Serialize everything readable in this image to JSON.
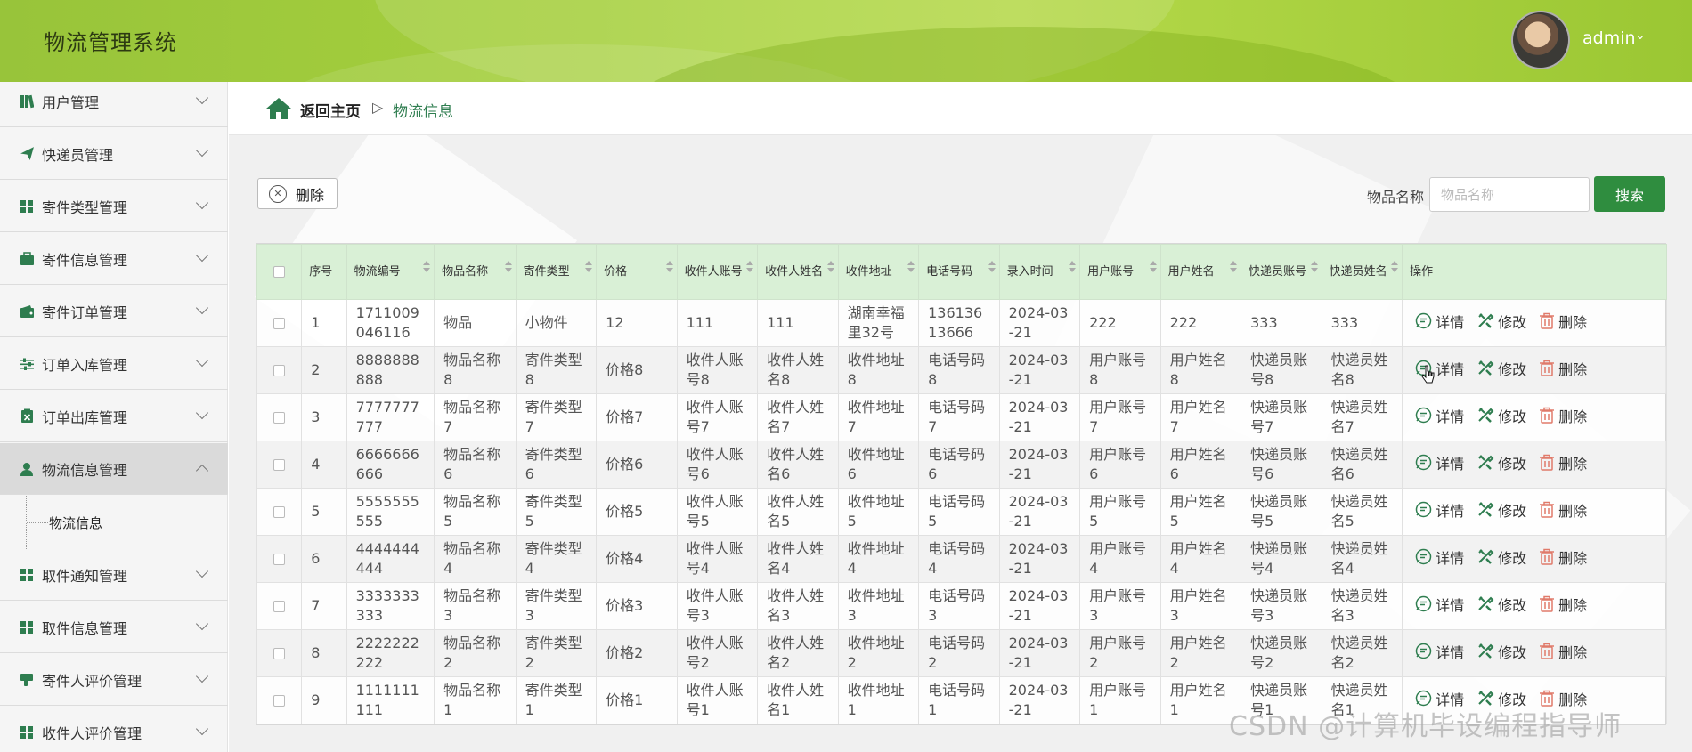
{
  "app": {
    "title": "物流管理系统",
    "user": "admin"
  },
  "sidebar": {
    "items": [
      {
        "label": "用户管理",
        "icon": "book-icon"
      },
      {
        "label": "快递员管理",
        "icon": "paper-plane-icon"
      },
      {
        "label": "寄件类型管理",
        "icon": "grid-icon"
      },
      {
        "label": "寄件信息管理",
        "icon": "briefcase-icon"
      },
      {
        "label": "寄件订单管理",
        "icon": "wallet-icon"
      },
      {
        "label": "订单入库管理",
        "icon": "sliders-icon"
      },
      {
        "label": "订单出库管理",
        "icon": "clipboard-x-icon"
      },
      {
        "label": "物流信息管理",
        "icon": "user-icon"
      },
      {
        "label": "取件通知管理",
        "icon": "grid-icon"
      },
      {
        "label": "取件信息管理",
        "icon": "grid-icon"
      },
      {
        "label": "寄件人评价管理",
        "icon": "thumbs-down-icon"
      },
      {
        "label": "收件人评价管理",
        "icon": "grid-icon"
      }
    ],
    "submenu_label": "物流信息"
  },
  "breadcrumb": {
    "home": "返回主页",
    "separator": "▷",
    "current": "物流信息"
  },
  "toolbar": {
    "delete_label": "删除",
    "search_label": "物品名称",
    "search_placeholder": "物品名称",
    "search_button": "搜索"
  },
  "table": {
    "columns": [
      "序号",
      "物流编号",
      "物品名称",
      "寄件类型",
      "价格",
      "收件人账号",
      "收件人姓名",
      "收件地址",
      "电话号码",
      "录入时间",
      "用户账号",
      "用户姓名",
      "快递员账号",
      "快递员姓名",
      "操作"
    ],
    "actions": {
      "detail": "详情",
      "edit": "修改",
      "delete": "删除"
    },
    "rows": [
      [
        "1",
        "1711009046116",
        "物品",
        "小物件",
        "12",
        "111",
        "111",
        "湖南幸福里32号",
        "13613613666",
        "2024-03-21",
        "222",
        "222",
        "333",
        "333"
      ],
      [
        "2",
        "8888888888",
        "物品名称8",
        "寄件类型8",
        "价格8",
        "收件人账号8",
        "收件人姓名8",
        "收件地址8",
        "电话号码8",
        "2024-03-21",
        "用户账号8",
        "用户姓名8",
        "快递员账号8",
        "快递员姓名8"
      ],
      [
        "3",
        "7777777777",
        "物品名称7",
        "寄件类型7",
        "价格7",
        "收件人账号7",
        "收件人姓名7",
        "收件地址7",
        "电话号码7",
        "2024-03-21",
        "用户账号7",
        "用户姓名7",
        "快递员账号7",
        "快递员姓名7"
      ],
      [
        "4",
        "6666666666",
        "物品名称6",
        "寄件类型6",
        "价格6",
        "收件人账号6",
        "收件人姓名6",
        "收件地址6",
        "电话号码6",
        "2024-03-21",
        "用户账号6",
        "用户姓名6",
        "快递员账号6",
        "快递员姓名6"
      ],
      [
        "5",
        "5555555555",
        "物品名称5",
        "寄件类型5",
        "价格5",
        "收件人账号5",
        "收件人姓名5",
        "收件地址5",
        "电话号码5",
        "2024-03-21",
        "用户账号5",
        "用户姓名5",
        "快递员账号5",
        "快递员姓名5"
      ],
      [
        "6",
        "4444444444",
        "物品名称4",
        "寄件类型4",
        "价格4",
        "收件人账号4",
        "收件人姓名4",
        "收件地址4",
        "电话号码4",
        "2024-03-21",
        "用户账号4",
        "用户姓名4",
        "快递员账号4",
        "快递员姓名4"
      ],
      [
        "7",
        "3333333333",
        "物品名称3",
        "寄件类型3",
        "价格3",
        "收件人账号3",
        "收件人姓名3",
        "收件地址3",
        "电话号码3",
        "2024-03-21",
        "用户账号3",
        "用户姓名3",
        "快递员账号3",
        "快递员姓名3"
      ],
      [
        "8",
        "2222222222",
        "物品名称2",
        "寄件类型2",
        "价格2",
        "收件人账号2",
        "收件人姓名2",
        "收件地址2",
        "电话号码2",
        "2024-03-21",
        "用户账号2",
        "用户姓名2",
        "快递员账号2",
        "快递员姓名2"
      ],
      [
        "9",
        "1111111111",
        "物品名称1",
        "寄件类型1",
        "价格1",
        "收件人账号1",
        "收件人姓名1",
        "收件地址1",
        "电话号码1",
        "2024-03-21",
        "用户账号1",
        "用户姓名1",
        "快递员账号1",
        "快递员姓名1"
      ]
    ]
  },
  "watermark": "CSDN @计算机毕设编程指导师",
  "colors": {
    "header": "#a6d03e",
    "accent": "#2f8d3f",
    "table_header": "#d9f0d6",
    "breadcrumb_current": "#2e7d4f"
  }
}
